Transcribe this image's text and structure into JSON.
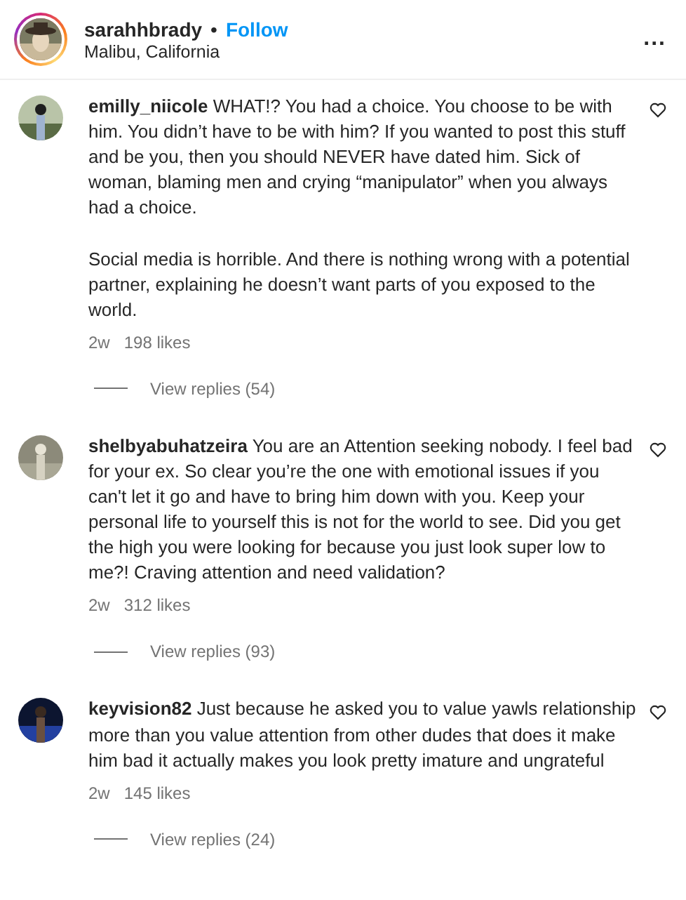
{
  "post_header": {
    "username": "sarahhbrady",
    "separator": "•",
    "follow": "Follow",
    "location": "Malibu, California",
    "more": "..."
  },
  "comments": [
    {
      "text": "**emilly_niicole** WHAT!? You had a choice. You choose to be with him. You didn’t have to be with him? If you wanted to post this stuff and be you, then you should NEVER have dated him. Sick of woman, blaming men and crying “manipulator” when you always had a choice.\n\nSocial media is horrible. And there is nothing wrong with a potential partner, explaining he doesn’t want parts of you exposed to the world.",
      "time": "2w",
      "likes": "198 likes",
      "replies": "View replies (54)"
    },
    {
      "text": "**shelbyabuhatzeira** You are an Attention seeking nobody. I feel bad for your ex. So clear you’re the one with emotional issues if you can't let it go and have to bring him down with you. Keep your personal life to yourself this is not for the world to see. Did you get the high you were looking for because you just look super low to me?! Craving attention and need validation?",
      "time": "2w",
      "likes": "312 likes",
      "replies": "View replies (93)"
    },
    {
      "text": "**keyvision82** Just because he asked you to value yawls relationship more than you value attention from other dudes that does it make him bad it actually makes you look pretty imature and ungrateful",
      "time": "2w",
      "likes": "145 likes",
      "replies": "View replies (24)"
    }
  ]
}
